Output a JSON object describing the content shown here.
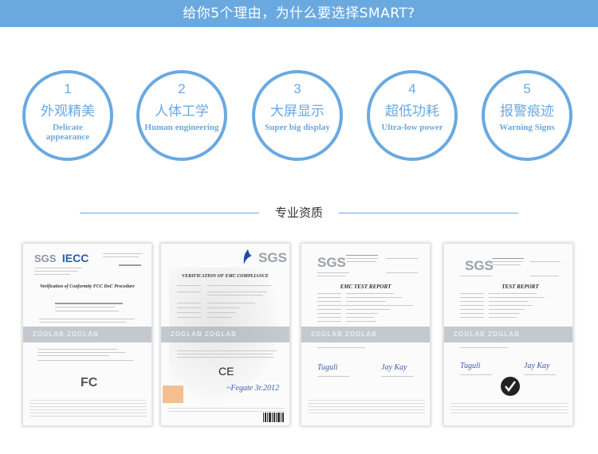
{
  "banner": {
    "title": "给你5个理由，为什么要选择SMART?"
  },
  "features": [
    {
      "num": "1",
      "cn": "外观精美",
      "en": "Delicate appearance"
    },
    {
      "num": "2",
      "cn": "人体工学",
      "en": "Human engineering"
    },
    {
      "num": "3",
      "cn": "大屏显示",
      "en": "Super big display"
    },
    {
      "num": "4",
      "cn": "超低功耗",
      "en": "Ultra-low power"
    },
    {
      "num": "5",
      "cn": "报警痕迹",
      "en": "Warning Signs"
    }
  ],
  "section": {
    "title": "专业资质"
  },
  "certificates": [
    {
      "logo_sgs": "SGS",
      "logo_iecc": "IECC",
      "title": "Verification of Conformity FCC DoC Procedure",
      "watermark": "ZOGLAB ZOGLAB",
      "mark": "FC"
    },
    {
      "logo_sgs": "SGS",
      "title": "VERIFICATION OF EMC COMPLIANCE",
      "watermark": "ZOGLAB ZOGLAB",
      "mark": "CE"
    },
    {
      "logo_sgs": "SGS",
      "title": "EMC TEST REPORT",
      "watermark": "ZOGLAB ZOGLAB"
    },
    {
      "logo_sgs": "SGS",
      "title": "TEST REPORT",
      "watermark": "ZOGLAB ZOGLAB"
    }
  ],
  "colors": {
    "accent": "#6aa9e0",
    "banner_text": "#ffffff",
    "heading_text": "#333333",
    "iecc_blue": "#1f5fb5"
  }
}
